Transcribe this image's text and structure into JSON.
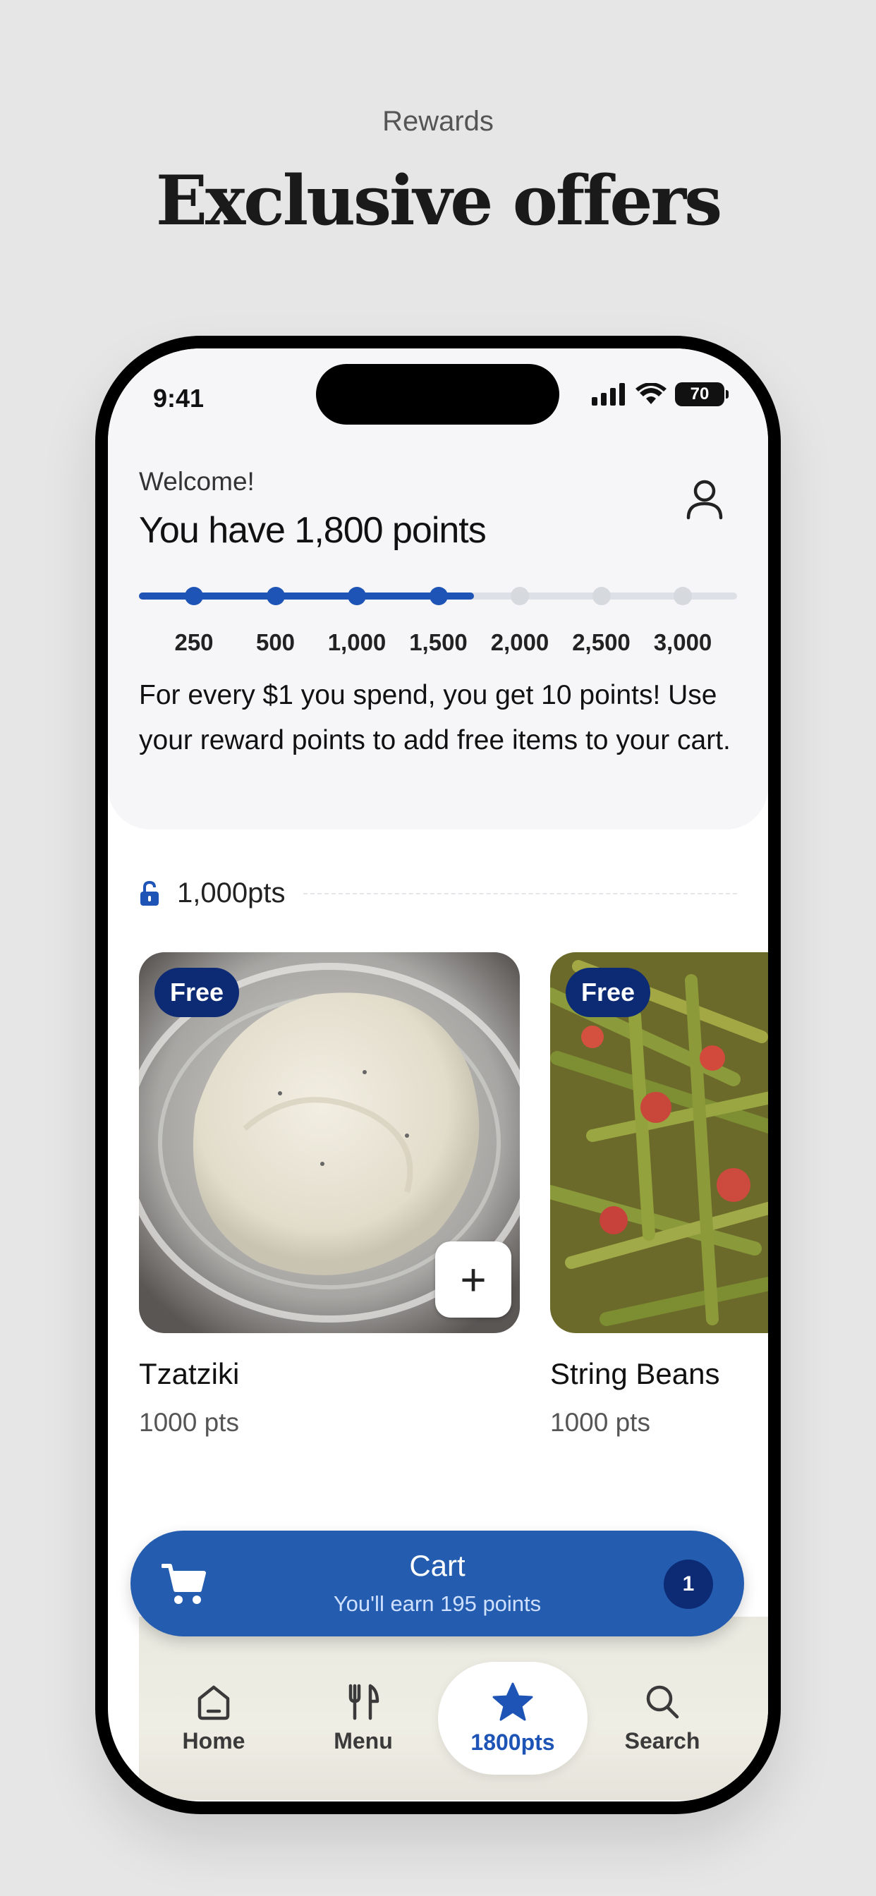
{
  "promo": {
    "kicker": "Rewards",
    "headline": "Exclusive offers"
  },
  "status_bar": {
    "time": "9:41",
    "battery": "70"
  },
  "header": {
    "welcome": "Welcome!",
    "points_title": "You have 1,800 points",
    "profile_icon": "person-icon"
  },
  "progress": {
    "current_points": 1800,
    "milestones": [
      "250",
      "500",
      "1,000",
      "1,500",
      "2,000",
      "2,500",
      "3,000"
    ],
    "reached_count": 4,
    "fill_fraction": 0.56
  },
  "info_text": "For every $1 you spend, you get 10 points! Use your reward points to add free items to your cart.",
  "tier": {
    "label": "1,000pts",
    "icon": "unlock-icon"
  },
  "rewards": [
    {
      "badge": "Free",
      "name": "Tzatziki",
      "points": "1000 pts"
    },
    {
      "badge": "Free",
      "name": "String Beans",
      "points": "1000 pts"
    }
  ],
  "cart": {
    "title": "Cart",
    "subtitle": "You'll earn 195 points",
    "count": "1"
  },
  "tabs": [
    {
      "label": "Home",
      "icon": "home-icon"
    },
    {
      "label": "Menu",
      "icon": "fork-knife-icon"
    },
    {
      "label": "1800pts",
      "icon": "star-icon"
    },
    {
      "label": "Search",
      "icon": "search-icon"
    }
  ],
  "colors": {
    "accent": "#1d54b5",
    "badge": "#0d2a74",
    "cart": "#245db0"
  }
}
